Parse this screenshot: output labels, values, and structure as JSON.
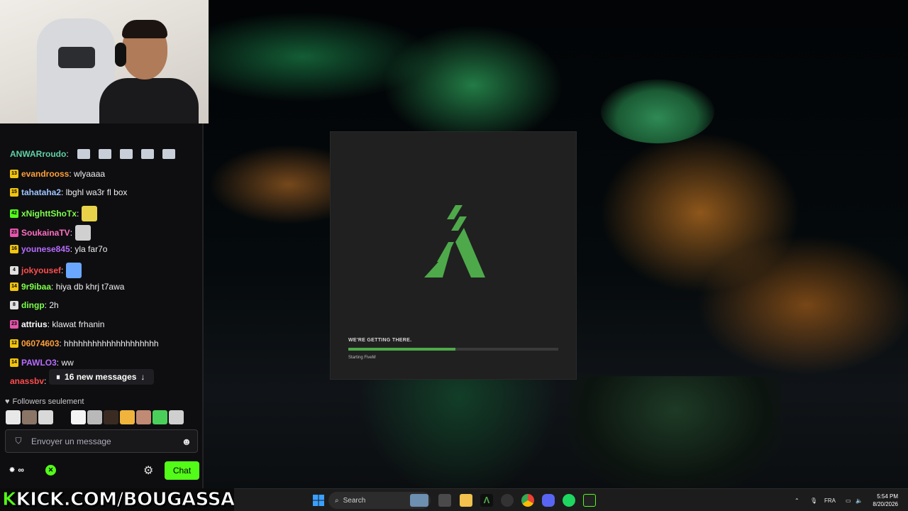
{
  "loader": {
    "caption": "WE'RE GETTING THERE.",
    "status": "Starting FiveM",
    "progress": 0.51,
    "accent": "#4ea94a"
  },
  "chat": {
    "messages": [
      {
        "badge": "",
        "badge_color": "",
        "user": "ANWARroudo",
        "user_color": "#5fd2a8",
        "text": ":"
      },
      {
        "badge": "13",
        "badge_color": "#f1c40f",
        "user": "evandrooss",
        "user_color": "#ff9f3a",
        "text": ": wlyaaaa"
      },
      {
        "badge": "15",
        "badge_color": "#f1c40f",
        "user": "tahataha2",
        "user_color": "#9fc3ff",
        "text": ": lbghl wa3r fl box"
      },
      {
        "badge": "42",
        "badge_color": "#53fc18",
        "user": "xNighttShoTx",
        "user_color": "#7dff4a",
        "text": ":"
      },
      {
        "badge": "23",
        "badge_color": "#e455ab",
        "user": "SoukainaTV",
        "user_color": "#ff6fc3",
        "text": ":"
      },
      {
        "badge": "16",
        "badge_color": "#f1c40f",
        "user": "younese845",
        "user_color": "#b76cff",
        "text": ": yla far7o"
      },
      {
        "badge": "4",
        "badge_color": "#e0e0e0",
        "user": "jokyousef",
        "user_color": "#ff4d4d",
        "text": ":"
      },
      {
        "badge": "14",
        "badge_color": "#f1c40f",
        "user": "9r9ibaa",
        "user_color": "#7dff4a",
        "text": ": hiya db khrj t7awa"
      },
      {
        "badge": "8",
        "badge_color": "#e0e0e0",
        "user": "dingp",
        "user_color": "#7dff4a",
        "text": ": 2h"
      },
      {
        "badge": "23",
        "badge_color": "#e455ab",
        "user": "attrius",
        "user_color": "#ffffff",
        "text": ": klawat frhanin"
      },
      {
        "badge": "12",
        "badge_color": "#f1c40f",
        "user": "06074603",
        "user_color": "#ff9f3a",
        "text": ": hhhhhhhhhhhhhhhhhhhh"
      },
      {
        "badge": "14",
        "badge_color": "#f1c40f",
        "user": "PAWLO3",
        "user_color": "#b76cff",
        "text": ": ww"
      },
      {
        "badge": "",
        "badge_color": "",
        "user": "anassbv",
        "user_color": "#ff4d4d",
        "text": ":"
      }
    ],
    "new_messages": "16 new messages",
    "followers_label": "Followers seulement",
    "input_placeholder": "Envoyer un message",
    "send_label": "Chat",
    "kick_green": "#53fc18"
  },
  "banner": {
    "k": "K",
    "text": "KICK.COM/BOUGASSAA"
  },
  "taskbar": {
    "search_placeholder": "Search",
    "language": "FRA",
    "time": "5:54 PM",
    "date": "8/20/2026"
  }
}
